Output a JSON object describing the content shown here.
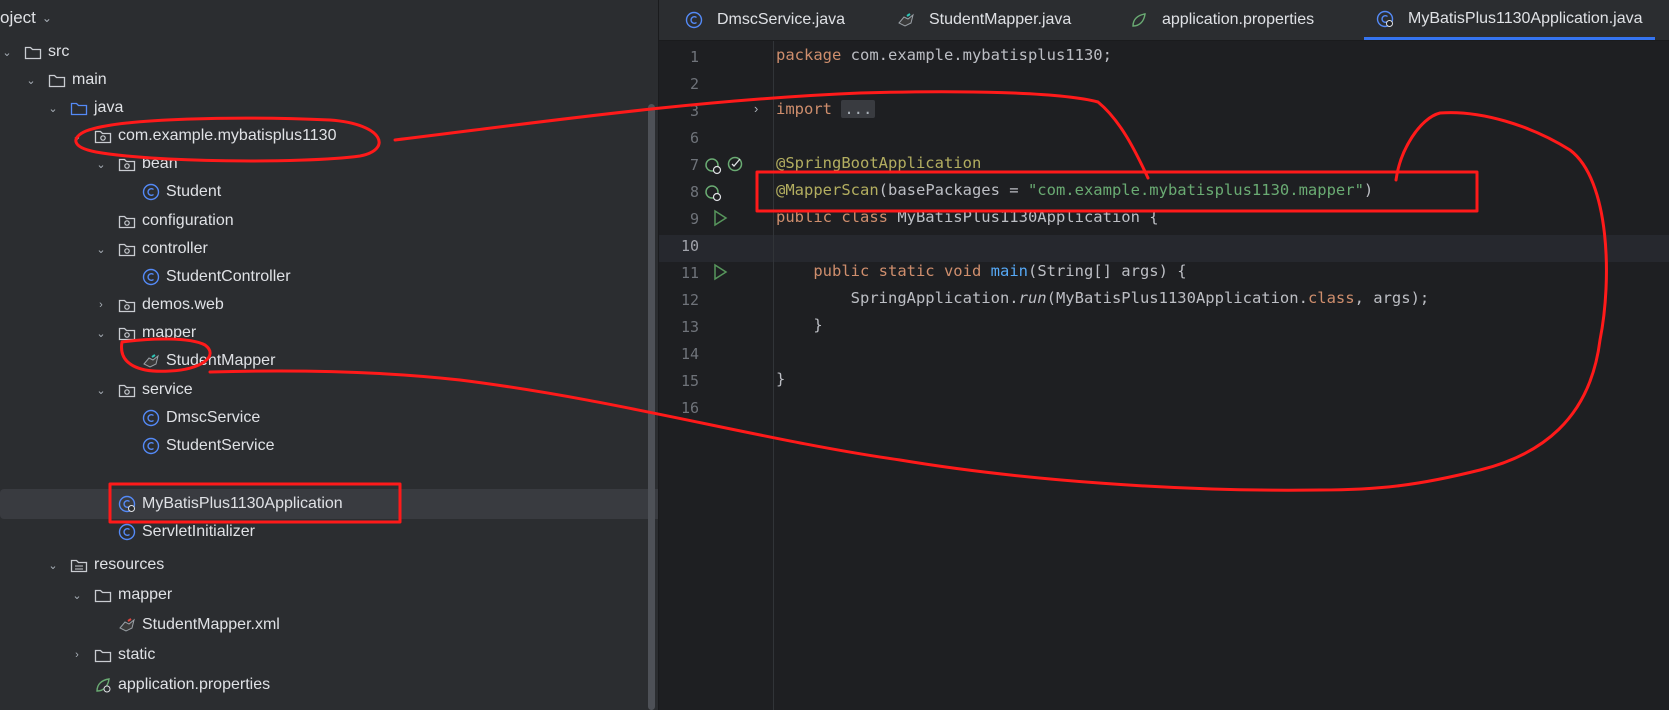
{
  "project_panel": {
    "title": "oject",
    "items": [
      {
        "label": "src",
        "type": "folder"
      },
      {
        "label": "main",
        "type": "folder"
      },
      {
        "label": "java",
        "type": "folder-src"
      },
      {
        "label": "com.example.mybatisplus1130",
        "type": "package"
      },
      {
        "label": "bean",
        "type": "package"
      },
      {
        "label": "Student",
        "type": "class"
      },
      {
        "label": "configuration",
        "type": "package"
      },
      {
        "label": "controller",
        "type": "package"
      },
      {
        "label": "StudentController",
        "type": "class"
      },
      {
        "label": "demos.web",
        "type": "package"
      },
      {
        "label": "mapper",
        "type": "package"
      },
      {
        "label": "StudentMapper",
        "type": "mapper"
      },
      {
        "label": "service",
        "type": "package"
      },
      {
        "label": "DmscService",
        "type": "class"
      },
      {
        "label": "StudentService",
        "type": "class"
      },
      {
        "label": "MyBatisPlus1130Application",
        "type": "app"
      },
      {
        "label": "ServletInitializer",
        "type": "class"
      },
      {
        "label": "resources",
        "type": "folder-res"
      },
      {
        "label": "mapper",
        "type": "folder"
      },
      {
        "label": "StudentMapper.xml",
        "type": "xml"
      },
      {
        "label": "static",
        "type": "folder"
      },
      {
        "label": "application.properties",
        "type": "props"
      }
    ]
  },
  "tabs": [
    {
      "label": "DmscService.java",
      "icon": "class-icon"
    },
    {
      "label": "StudentMapper.java",
      "icon": "mapper-bird-icon"
    },
    {
      "label": "application.properties",
      "icon": "spring-leaf-icon"
    },
    {
      "label": "MyBatisPlus1130Application.java",
      "icon": "app-class-icon",
      "active": true
    }
  ],
  "code": {
    "line_numbers": [
      "1",
      "2",
      "3",
      "6",
      "7",
      "8",
      "9",
      "10",
      "11",
      "12",
      "13",
      "14",
      "15",
      "16"
    ],
    "line1": {
      "kw": "package",
      "rest": " com.example.mybatisplus1130;"
    },
    "line3": {
      "kw": "import",
      "fold": "..."
    },
    "line7": {
      "ann": "@SpringBootApplication"
    },
    "line8": {
      "ann": "@MapperScan",
      "open": "(basePackages = ",
      "str": "\"com.example.mybatisplus1130.mapper\"",
      "close": ")"
    },
    "line9": {
      "kw": "public class",
      "rest": " MyBatisPlus1130Application {"
    },
    "line11": {
      "indent": "    ",
      "kw": "public static void",
      "sp": " ",
      "fn": "main",
      "rest": "(String[] args) {"
    },
    "line12": {
      "indent": "        ",
      "cls": "SpringApplication.",
      "it": "run",
      "mid": "(MyBatisPlus1130Application.",
      "kw": "class",
      "rest": ", args);"
    },
    "line13": {
      "text": "    }"
    },
    "line15": {
      "text": "}"
    }
  },
  "colors": {
    "annotation_red": "#ff1a1a",
    "accent": "#3574f0"
  }
}
